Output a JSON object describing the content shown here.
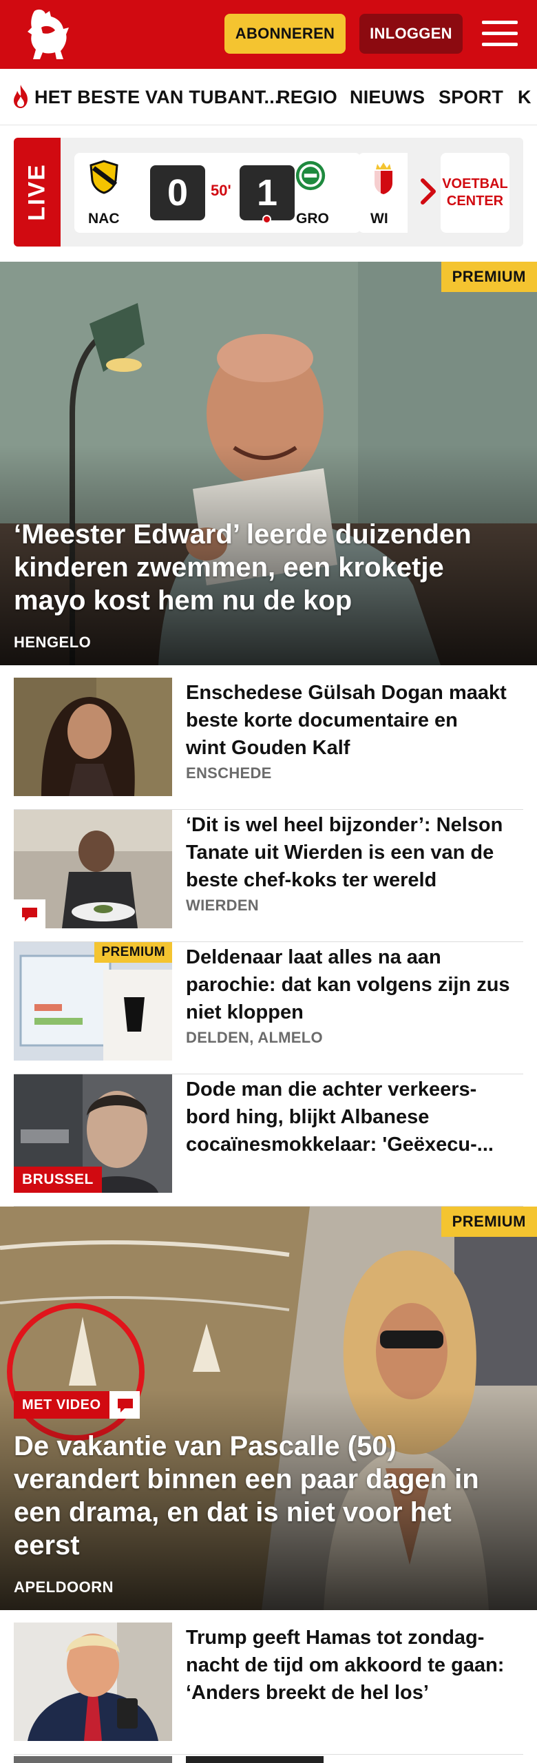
{
  "header": {
    "logo_icon": "tubantia-horse-logo-icon",
    "subscribe_label": "ABONNEREN",
    "login_label": "INLOGGEN",
    "menu_icon": "hamburger-menu-icon",
    "brand_color": "#d10a11",
    "accent_color": "#f4c430"
  },
  "nav": {
    "items": [
      {
        "label": "HET BESTE VAN TUBANT...",
        "icon": "flame-icon"
      },
      {
        "label": "REGIO"
      },
      {
        "label": "NIEUWS"
      },
      {
        "label": "SPORT"
      },
      {
        "label": "K"
      }
    ]
  },
  "live": {
    "tag": "LIVE",
    "match": {
      "home_code": "NAC",
      "home_score": "0",
      "minute": "50'",
      "away_score": "1",
      "away_code": "GRO"
    },
    "next_match_code": "WI",
    "next_icon": "chevron-right-icon",
    "voetbal_center_label": "VOETBAL CENTER"
  },
  "hero": {
    "badge": "PREMIUM",
    "title": "‘Meester Edward’ leerde duizenden kinderen zwemmen, een kroketje mayo kost hem nu de kop",
    "title_lines": [
      "‘Meester Edward’ leerde duizenden",
      "kinderen zwemmen, een kroketje",
      "mayo kost hem nu de kop"
    ],
    "location": "HENGELO"
  },
  "articles": [
    {
      "title_lines": [
        "Enschedese Gülsah Dogan maakt",
        "beste korte documentaire en",
        "wint Gouden Kalf"
      ],
      "location": "ENSCHEDE"
    },
    {
      "title_lines": [
        "‘Dit is wel heel bijzonder’: Nelson",
        "Tanate uit Wierden is een van de",
        "beste chef-koks ter wereld"
      ],
      "location": "WIERDEN",
      "has_comments_icon": true
    },
    {
      "title_lines": [
        "Deldenaar laat alles na aan",
        "parochie: dat kan volgens zijn zus",
        "niet kloppen"
      ],
      "location": "DELDEN, ALMELO",
      "badge": "PREMIUM"
    },
    {
      "title_lines": [
        "Dode man die achter verkeers-",
        "bord hing, blijkt Albanese",
        "cocaïnesmokkelaar: 'Geëxecu-..."
      ],
      "thumb_label": "BRUSSEL"
    }
  ],
  "hero2": {
    "badge": "PREMIUM",
    "video_label": "MET VIDEO",
    "title_lines": [
      "De vakantie van Pascalle (50)",
      "verandert binnen een paar dagen in",
      "een drama, en dat is niet voor het",
      "eerst"
    ],
    "location": "APELDOORN"
  },
  "articles2": [
    {
      "title_lines": [
        "Trump geeft Hamas tot zondag-",
        "nacht de tijd om akkoord te gaan:",
        "‘Anders breekt de hel los’"
      ]
    }
  ]
}
